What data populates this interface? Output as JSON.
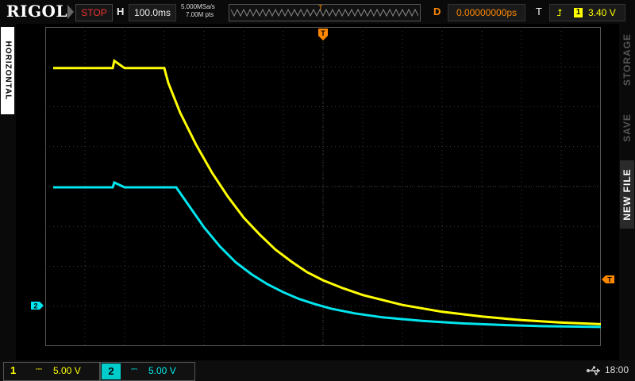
{
  "topbar": {
    "brand": "RIGOL",
    "run_state": "STOP",
    "horizontal_label": "H",
    "timebase": "100.0ms",
    "sample_rate": "5.000MSa/s",
    "memory_depth": "7.00M pts",
    "trigger_position_marker": "T",
    "delay_label": "D",
    "delay_value": "0.00000000ps",
    "trigger_label": "T",
    "trigger_channel": "1",
    "trigger_level": "3.40 V"
  },
  "left_menu": {
    "tab_label": "HORIZONTAL"
  },
  "right_menu": {
    "tabs": [
      "STORAGE",
      "SAVE",
      "NEW FILE"
    ]
  },
  "markers": {
    "trigger_top": "T",
    "trigger_level": "T",
    "ch2_ground": "2"
  },
  "bottombar": {
    "ch1": {
      "label": "1",
      "coupling": "⎓",
      "scale": "5.00 V"
    },
    "ch2": {
      "label": "2",
      "coupling": "⎓",
      "scale": "5.00 V"
    },
    "usb_icon": "⭠",
    "time": "18:00"
  },
  "colors": {
    "ch1": "#ffff00",
    "ch2": "#00e5ee",
    "trigger": "#ff8800",
    "grid": "#3a3a3a"
  },
  "chart_data": {
    "type": "line",
    "x_unit": "div",
    "y_unit": "div",
    "xlim": [
      -7,
      7
    ],
    "ylim": [
      -4,
      4
    ],
    "series": [
      {
        "name": "1",
        "x": [
          -6.8,
          -5.3,
          -5.26,
          -5.0,
          -4.0,
          -3.9,
          -3.6,
          -3.2,
          -2.8,
          -2.4,
          -2.0,
          -1.6,
          -1.2,
          -0.8,
          -0.4,
          0.0,
          0.5,
          1.0,
          2.0,
          3.0,
          4.0,
          5.0,
          6.0,
          7.0
        ],
        "y": [
          2.97,
          2.97,
          3.15,
          2.97,
          2.97,
          2.6,
          1.85,
          1.05,
          0.35,
          -0.25,
          -0.78,
          -1.2,
          -1.58,
          -1.88,
          -2.15,
          -2.35,
          -2.55,
          -2.72,
          -2.97,
          -3.14,
          -3.26,
          -3.35,
          -3.41,
          -3.45
        ]
      },
      {
        "name": "2",
        "x": [
          -6.8,
          -5.3,
          -5.26,
          -5.0,
          -3.7,
          -3.4,
          -3.0,
          -2.6,
          -2.2,
          -1.8,
          -1.4,
          -1.0,
          -0.6,
          -0.2,
          0.2,
          0.8,
          1.5,
          2.5,
          3.5,
          4.5,
          5.5,
          7.0
        ],
        "y": [
          -0.02,
          -0.02,
          0.1,
          -0.02,
          -0.02,
          -0.45,
          -1.02,
          -1.5,
          -1.9,
          -2.2,
          -2.45,
          -2.65,
          -2.82,
          -2.95,
          -3.06,
          -3.18,
          -3.28,
          -3.37,
          -3.43,
          -3.47,
          -3.5,
          -3.52
        ]
      }
    ]
  }
}
